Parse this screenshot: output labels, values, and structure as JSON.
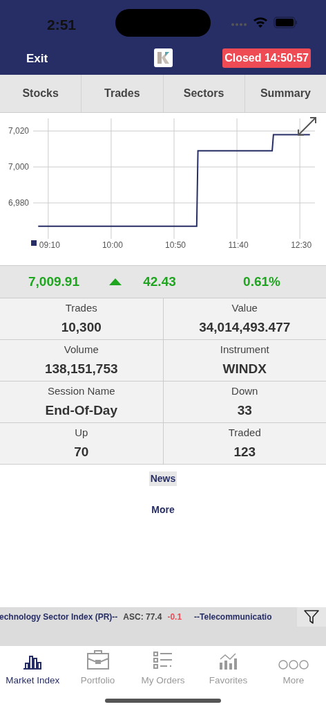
{
  "status_bar": {
    "time": "2:51"
  },
  "header": {
    "exit": "Exit",
    "market_status": "Closed 14:50:57"
  },
  "tabs": [
    {
      "label": "Stocks"
    },
    {
      "label": "Trades"
    },
    {
      "label": "Sectors"
    },
    {
      "label": "Summary"
    }
  ],
  "chart": {
    "chart_data": {
      "type": "line",
      "x": [
        542,
        668,
        669,
        728,
        729,
        758
      ],
      "series": [
        {
          "color": "#272e66",
          "values": [
            6967,
            6967,
            7009,
            7009,
            7018,
            7018
          ]
        }
      ],
      "xlim": [
        538,
        762
      ],
      "ylim": [
        6960,
        7027
      ],
      "xticks": [
        {
          "value": 550,
          "label": "09:10"
        },
        {
          "value": 600,
          "label": "10:00"
        },
        {
          "value": 650,
          "label": "10:50"
        },
        {
          "value": 700,
          "label": "11:40"
        },
        {
          "value": 750,
          "label": "12:30"
        }
      ],
      "yticks": [
        {
          "value": 6980,
          "label": "6,980"
        },
        {
          "value": 7000,
          "label": "7,000"
        },
        {
          "value": 7020,
          "label": "7,020"
        }
      ],
      "grid": true
    }
  },
  "summary": {
    "value": "7,009.91",
    "rising": true,
    "change": "42.43",
    "percent": "0.61%"
  },
  "stats": [
    {
      "label": "Trades",
      "value": "10,300"
    },
    {
      "label": "Value",
      "value": "34,014,493.477"
    },
    {
      "label": "Volume",
      "value": "138,151,753"
    },
    {
      "label": "Instrument",
      "value": "WINDX"
    },
    {
      "label": "Session Name",
      "value": "End-Of-Day"
    },
    {
      "label": "Down",
      "value": "33"
    },
    {
      "label": "Up",
      "value": "70"
    },
    {
      "label": "Traded",
      "value": "123"
    }
  ],
  "links": [
    "News",
    "More"
  ],
  "ticker": [
    {
      "kind": "name",
      "text": "echnology Sector Index (PR)--"
    },
    {
      "kind": "quote",
      "text": "ASC: 77.4"
    },
    {
      "kind": "change",
      "text": "-0.1"
    },
    {
      "kind": "name",
      "text": "--Telecommunicatio"
    }
  ],
  "bottom_nav": [
    {
      "label": "Market Index",
      "selected": true
    },
    {
      "label": "Portfolio",
      "selected": false
    },
    {
      "label": "My Orders",
      "selected": false
    },
    {
      "label": "Favorites",
      "selected": false
    },
    {
      "label": "More",
      "selected": false
    }
  ]
}
